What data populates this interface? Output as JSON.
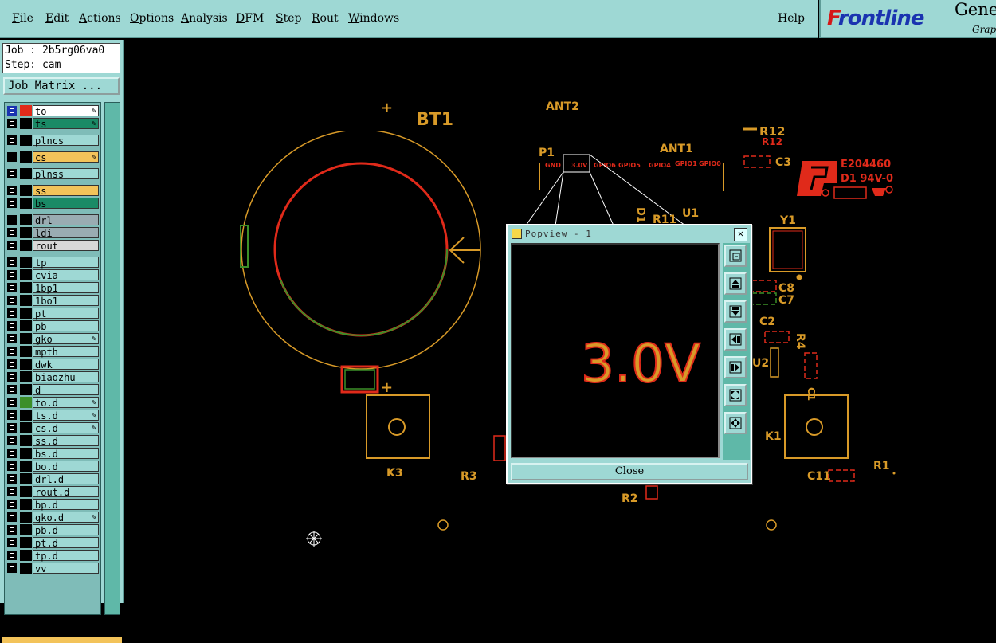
{
  "menu": {
    "items": [
      {
        "ul": "F",
        "rest": "ile"
      },
      {
        "ul": "E",
        "rest": "dit"
      },
      {
        "ul": "A",
        "rest": "ctions"
      },
      {
        "ul": "O",
        "rest": "ptions"
      },
      {
        "ul": "A",
        "rest": "nalysis"
      },
      {
        "ul": "D",
        "rest": "FM"
      },
      {
        "ul": "S",
        "rest": "tep"
      },
      {
        "ul": "R",
        "rest": "out"
      },
      {
        "ul": "W",
        "rest": "indows"
      }
    ],
    "help": "Help"
  },
  "brand": {
    "logo_a": "F",
    "logo_b": "rontline",
    "gene": "Gene",
    "grap": "Grap"
  },
  "job": {
    "job_line": "Job : 2b5rg06va0",
    "step_line": "Step: cam",
    "matrix_button": "Job Matrix ..."
  },
  "layers": [
    {
      "name": "to",
      "color": "#ffffff",
      "marker": "✎"
    },
    {
      "name": "ts",
      "color": "#1a8a66",
      "marker": "✎"
    },
    {
      "name": "plncs",
      "color": "#9ed8d4",
      "marker": ""
    },
    {
      "name": "cs",
      "color": "#f3c35a",
      "marker": "✎"
    },
    {
      "name": "plnss",
      "color": "#9ed8d4",
      "marker": ""
    },
    {
      "name": "ss",
      "color": "#f3c35a",
      "marker": ""
    },
    {
      "name": "bs",
      "color": "#1a8a66",
      "marker": ""
    },
    {
      "name": "drl",
      "color": "#9aacb2",
      "marker": ""
    },
    {
      "name": "ldi",
      "color": "#9aacb2",
      "marker": ""
    },
    {
      "name": "rout",
      "color": "#d8d8d8",
      "marker": ""
    },
    {
      "name": "tp",
      "color": "#9ed8d4",
      "marker": ""
    },
    {
      "name": "cvia",
      "color": "#9ed8d4",
      "marker": ""
    },
    {
      "name": "1bp1",
      "color": "#9ed8d4",
      "marker": ""
    },
    {
      "name": "1bo1",
      "color": "#9ed8d4",
      "marker": ""
    },
    {
      "name": "pt",
      "color": "#9ed8d4",
      "marker": ""
    },
    {
      "name": "pb",
      "color": "#9ed8d4",
      "marker": ""
    },
    {
      "name": "gko",
      "color": "#9ed8d4",
      "marker": "✎"
    },
    {
      "name": "mpth",
      "color": "#9ed8d4",
      "marker": ""
    },
    {
      "name": "dwk",
      "color": "#9ed8d4",
      "marker": ""
    },
    {
      "name": "biaozhu",
      "color": "#9ed8d4",
      "marker": ""
    },
    {
      "name": "d",
      "color": "#9ed8d4",
      "marker": ""
    },
    {
      "name": "to.d",
      "color": "#9ed8d4",
      "marker": "✎"
    },
    {
      "name": "ts.d",
      "color": "#9ed8d4",
      "marker": "✎"
    },
    {
      "name": "cs.d",
      "color": "#9ed8d4",
      "marker": "✎"
    },
    {
      "name": "ss.d",
      "color": "#9ed8d4",
      "marker": ""
    },
    {
      "name": "bs.d",
      "color": "#9ed8d4",
      "marker": ""
    },
    {
      "name": "bo.d",
      "color": "#9ed8d4",
      "marker": ""
    },
    {
      "name": "drl.d",
      "color": "#9ed8d4",
      "marker": ""
    },
    {
      "name": "rout.d",
      "color": "#9ed8d4",
      "marker": ""
    },
    {
      "name": "bp.d",
      "color": "#9ed8d4",
      "marker": ""
    },
    {
      "name": "gko.d",
      "color": "#9ed8d4",
      "marker": "✎"
    },
    {
      "name": "pb.d",
      "color": "#9ed8d4",
      "marker": ""
    },
    {
      "name": "pt.d",
      "color": "#9ed8d4",
      "marker": ""
    },
    {
      "name": "tp.d",
      "color": "#9ed8d4",
      "marker": ""
    },
    {
      "name": "vv",
      "color": "#9ed8d4",
      "marker": ""
    }
  ],
  "pcb": {
    "bt1": "BT1",
    "ant2": "ANT2",
    "ant1": "ANT1",
    "p1": "P1",
    "gnd": "GND",
    "v30": "3.0V",
    "gpio6": "GPIO6",
    "gpio5": "GPIO5",
    "gpio4": "GPIO4",
    "gpio1": "GPIO1",
    "gpio0": "GPIO0",
    "r12": "R12",
    "r12b": "R12",
    "c3": "C3",
    "u1": "U1",
    "r11": "R11",
    "d1label": "D1",
    "y1": "Y1",
    "c8": "C8",
    "c7": "C7",
    "c2": "C2",
    "r4": "R4",
    "u2": "U2",
    "c1": "C1",
    "k1": "K1",
    "k3": "K3",
    "r3": "R3",
    "r2": "R2",
    "r1": "R1",
    "c11": "C11",
    "e_code": "E204460",
    "e_sub": "D1  94V-0"
  },
  "popup": {
    "title": "Popview - 1",
    "zoom_text": "3.0V",
    "close": "Close"
  }
}
